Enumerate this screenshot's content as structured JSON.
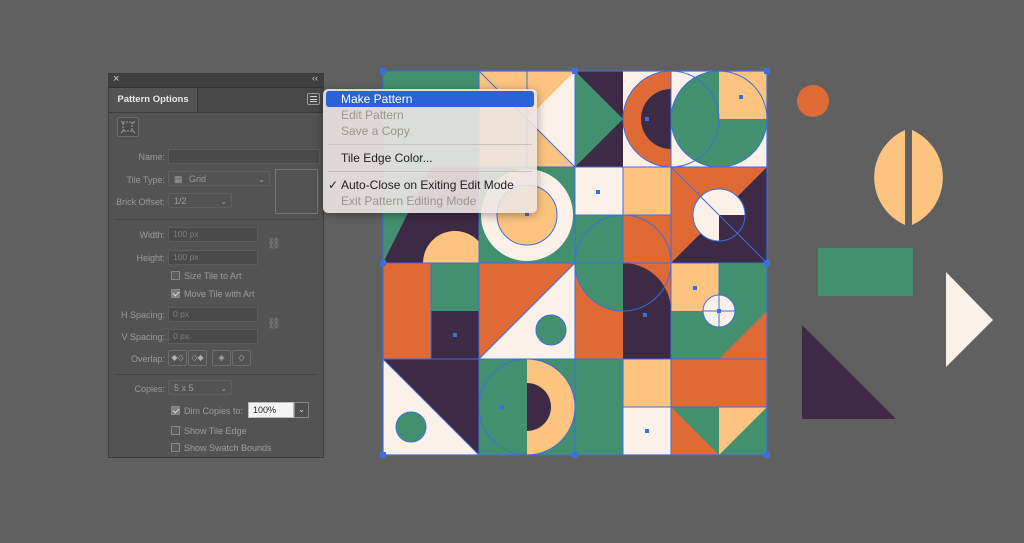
{
  "panel": {
    "close_glyph": "×",
    "collapse_glyph": "‹‹",
    "tab_label": "Pattern Options",
    "name_label": "Name:",
    "tile_type_label": "Tile Type:",
    "tile_type_value": "Grid",
    "brick_offset_label": "Brick Offset:",
    "brick_offset_value": "1/2",
    "width_label": "Width:",
    "width_value": "100 px",
    "height_label": "Height:",
    "height_value": "100 px",
    "size_tile_label": "Size Tile to Art",
    "move_tile_label": "Move Tile with Art",
    "h_spacing_label": "H Spacing:",
    "h_spacing_value": "0 px",
    "v_spacing_label": "V Spacing:",
    "v_spacing_value": "0 px",
    "overlap_label": "Overlap:",
    "copies_label": "Copies:",
    "copies_value": "5 x 5",
    "dim_copies_label": "Dim Copies to:",
    "dim_copies_value": "100%",
    "show_tile_edge_label": "Show Tile Edge",
    "show_swatch_bounds_label": "Show Swatch Bounds",
    "checks": {
      "size_tile": false,
      "move_tile": true,
      "dim_copies": true,
      "show_tile_edge": false,
      "show_swatch_bounds": false
    }
  },
  "menu": {
    "items": [
      {
        "label": "Make Pattern",
        "state": "selected"
      },
      {
        "label": "Edit Pattern",
        "state": "disabled"
      },
      {
        "label": "Save a Copy",
        "state": "disabled"
      },
      {
        "label": "Tile Edge Color...",
        "state": "enabled"
      },
      {
        "label": "Auto-Close on Exiting Edit Mode",
        "state": "checked"
      },
      {
        "label": "Exit Pattern Editing Mode",
        "state": "disabled"
      }
    ],
    "check_glyph": "✓"
  },
  "colors": {
    "background": "#606060",
    "orange": "#E06A35",
    "peach": "#FDC47F",
    "green": "#42906F",
    "navy": "#3D2A45",
    "cream": "#FBF1E8",
    "selection_blue": "#3B6FE0",
    "menu_highlight": "#2A63D6"
  },
  "icons": [
    "close-icon",
    "collapse-icon",
    "panel-menu-icon",
    "tile-edit-icon",
    "grid-icon",
    "chevron-down-icon",
    "link-icon",
    "overlap-icon",
    "checkmark-icon"
  ]
}
